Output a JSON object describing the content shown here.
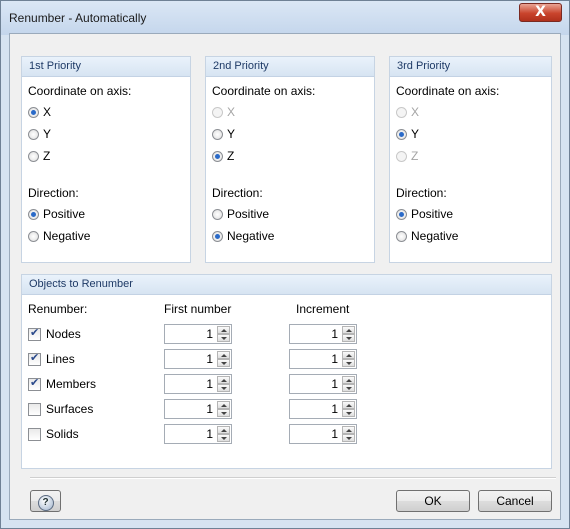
{
  "window": {
    "title": "Renumber - Automatically",
    "close_label": "X"
  },
  "priorities": [
    {
      "header": "1st Priority",
      "coordinate_label": "Coordinate on axis:",
      "axes": [
        {
          "label": "X",
          "selected": true,
          "enabled": true
        },
        {
          "label": "Y",
          "selected": false,
          "enabled": true
        },
        {
          "label": "Z",
          "selected": false,
          "enabled": true
        }
      ],
      "direction_label": "Direction:",
      "directions": [
        {
          "label": "Positive",
          "selected": true
        },
        {
          "label": "Negative",
          "selected": false
        }
      ]
    },
    {
      "header": "2nd Priority",
      "coordinate_label": "Coordinate on axis:",
      "axes": [
        {
          "label": "X",
          "selected": false,
          "enabled": false
        },
        {
          "label": "Y",
          "selected": false,
          "enabled": true
        },
        {
          "label": "Z",
          "selected": true,
          "enabled": true
        }
      ],
      "direction_label": "Direction:",
      "directions": [
        {
          "label": "Positive",
          "selected": false
        },
        {
          "label": "Negative",
          "selected": true
        }
      ]
    },
    {
      "header": "3rd Priority",
      "coordinate_label": "Coordinate on axis:",
      "axes": [
        {
          "label": "X",
          "selected": false,
          "enabled": false
        },
        {
          "label": "Y",
          "selected": true,
          "enabled": true
        },
        {
          "label": "Z",
          "selected": false,
          "enabled": false
        }
      ],
      "direction_label": "Direction:",
      "directions": [
        {
          "label": "Positive",
          "selected": true
        },
        {
          "label": "Negative",
          "selected": false
        }
      ]
    }
  ],
  "objects": {
    "header": "Objects to Renumber",
    "renumber_label": "Renumber:",
    "first_number_label": "First number",
    "increment_label": "Increment",
    "rows": [
      {
        "label": "Nodes",
        "checked": true,
        "first": "1",
        "increment": "1"
      },
      {
        "label": "Lines",
        "checked": true,
        "first": "1",
        "increment": "1"
      },
      {
        "label": "Members",
        "checked": true,
        "first": "1",
        "increment": "1"
      },
      {
        "label": "Surfaces",
        "checked": false,
        "first": "1",
        "increment": "1"
      },
      {
        "label": "Solids",
        "checked": false,
        "first": "1",
        "increment": "1"
      }
    ]
  },
  "buttons": {
    "help_icon": "?",
    "ok": "OK",
    "cancel": "Cancel"
  }
}
